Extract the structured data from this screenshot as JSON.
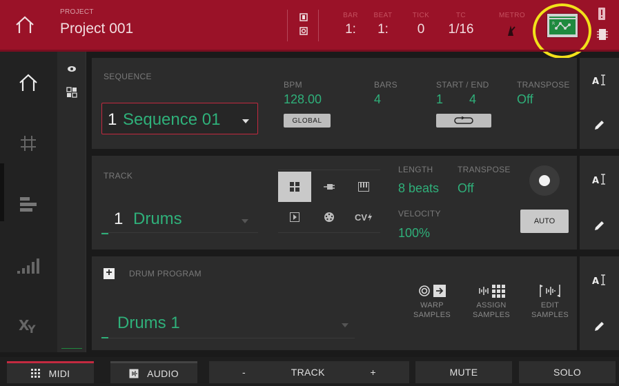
{
  "header": {
    "project_label": "PROJECT",
    "project_name": "Project 001",
    "bar_label": "BAR",
    "bar_value": "1:",
    "beat_label": "BEAT",
    "beat_value": "1:",
    "tick_label": "TICK",
    "tick_value": "0",
    "tc_label": "TC",
    "tc_value": "1/16",
    "metro_label": "METRO",
    "icons": [
      "home-icon",
      "chip-icon",
      "warning-icon",
      "battery-icon",
      "metronome-icon"
    ]
  },
  "sequence": {
    "label": "SEQUENCE",
    "number": "1",
    "name": "Sequence 01",
    "bpm_label": "BPM",
    "bpm_value": "128.00",
    "global_label": "GLOBAL",
    "bars_label": "BARS",
    "bars_value": "4",
    "start_end_label": "START / END",
    "start_value": "1",
    "end_value": "4",
    "transpose_label": "TRANSPOSE",
    "transpose_value": "Off"
  },
  "track": {
    "label": "TRACK",
    "number": "1",
    "name": "Drums",
    "length_label": "LENGTH",
    "length_value": "8 beats",
    "transpose_label": "TRANSPOSE",
    "transpose_value": "Off",
    "velocity_label": "VELOCITY",
    "velocity_value": "100%",
    "auto_label": "AUTO",
    "cv_label": "CV"
  },
  "program": {
    "label": "DRUM PROGRAM",
    "name": "Drums 1",
    "tools": [
      {
        "line1": "WARP",
        "line2": "SAMPLES"
      },
      {
        "line1": "ASSIGN",
        "line2": "SAMPLES"
      },
      {
        "line1": "EDIT",
        "line2": "SAMPLES"
      }
    ]
  },
  "bottom": {
    "midi": "MIDI",
    "audio": "AUDIO",
    "minus": "-",
    "track": "TRACK",
    "plus": "+",
    "mute": "MUTE",
    "solo": "SOLO"
  },
  "colors": {
    "header": "#9a1228",
    "accent_green": "#2fb07a",
    "highlight": "#f2e11a"
  }
}
